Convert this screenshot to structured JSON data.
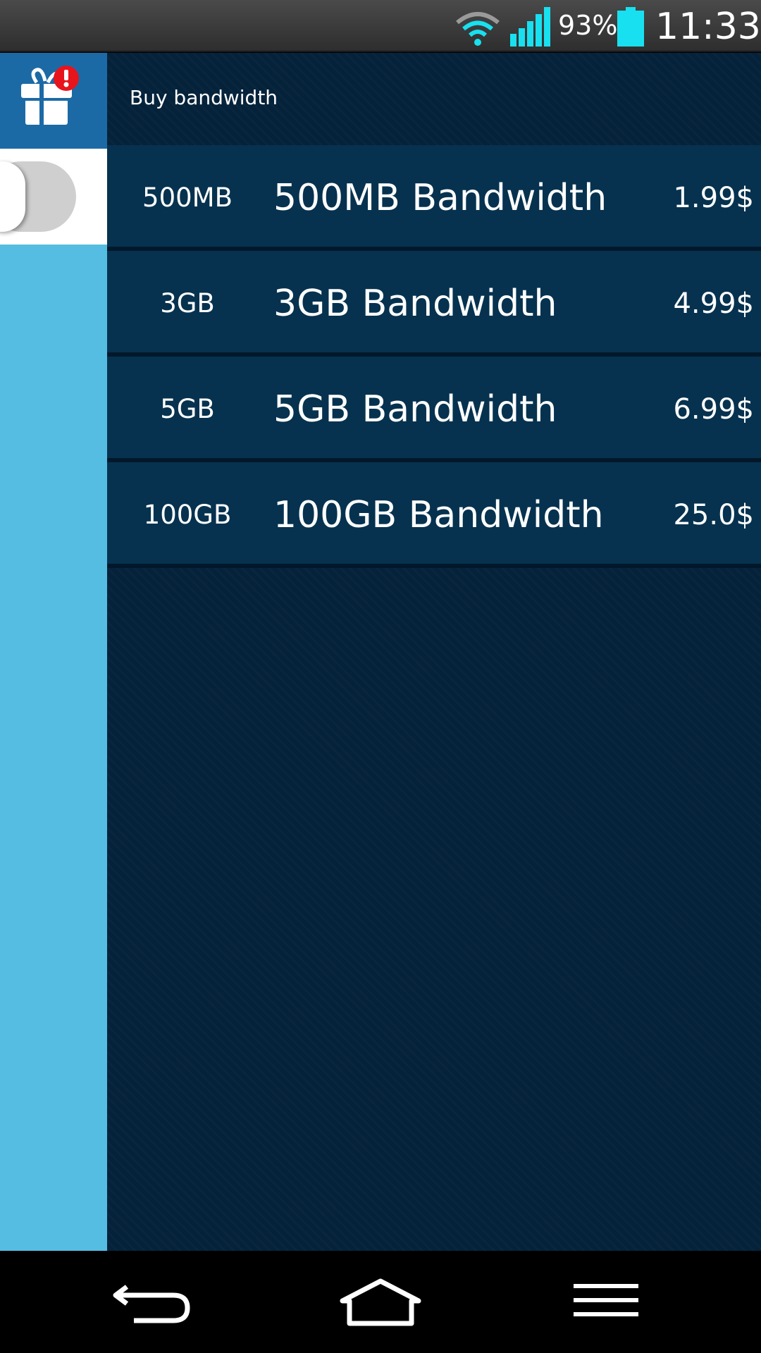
{
  "status_bar": {
    "battery_percent": "93%",
    "time": "11:33",
    "icons": [
      "wifi-icon",
      "signal-icon",
      "battery-icon"
    ],
    "accent_color": "#18e0f0"
  },
  "side_panel": {
    "gift_icon": "gift-icon",
    "alert_badge": "!",
    "toggle_state": "off"
  },
  "header": {
    "title": "Buy bandwidth"
  },
  "products": [
    {
      "size": "500MB",
      "name": "500MB Bandwidth",
      "price": "1.99$"
    },
    {
      "size": "3GB",
      "name": "3GB Bandwidth",
      "price": "4.99$"
    },
    {
      "size": "5GB",
      "name": "5GB Bandwidth",
      "price": "6.99$"
    },
    {
      "size": "100GB",
      "name": "100GB Bandwidth",
      "price": "25.0$"
    }
  ],
  "nav_bar": {
    "icons": [
      "back-icon",
      "home-icon",
      "menu-icon"
    ]
  },
  "colors": {
    "side_panel": "#55bde2",
    "gift_cell": "#1c6aa5",
    "main_background": "#04223a",
    "row_background": "#06324f",
    "badge": "#e8141c"
  }
}
